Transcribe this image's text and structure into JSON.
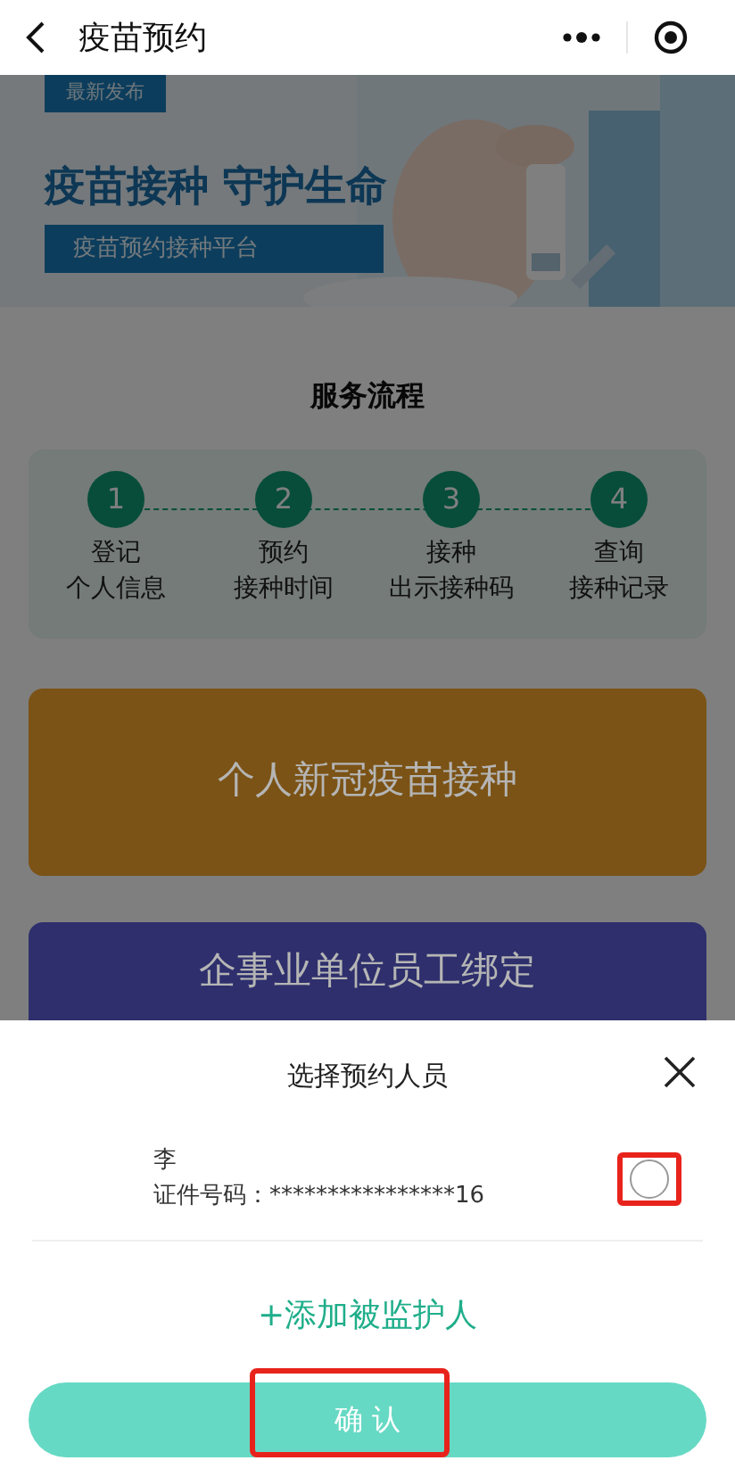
{
  "nav": {
    "title": "疫苗预约"
  },
  "banner": {
    "badge": "最新发布",
    "headline": "疫苗接种 守护生命",
    "subtitle": "疫苗预约接种平台"
  },
  "process": {
    "title": "服务流程",
    "steps": [
      {
        "number": "1",
        "line1": "登记",
        "line2": "个人信息"
      },
      {
        "number": "2",
        "line1": "预约",
        "line2": "接种时间"
      },
      {
        "number": "3",
        "line1": "接种",
        "line2": "出示接种码"
      },
      {
        "number": "4",
        "line1": "查询",
        "line2": "接种记录"
      }
    ]
  },
  "entries": [
    {
      "label": "个人新冠疫苗接种",
      "color": "#7b5316"
    },
    {
      "label": "企事业单位员工绑定",
      "color": "#2e2f6c"
    }
  ],
  "sheet": {
    "title": "选择预约人员",
    "people": [
      {
        "name": "李",
        "id_label": "证件号码：",
        "id_value": "****************16",
        "selected": false,
        "highlighted": true
      }
    ],
    "add_link": "+添加被监护人",
    "confirm": {
      "label": "确 认",
      "highlighted": true
    }
  }
}
